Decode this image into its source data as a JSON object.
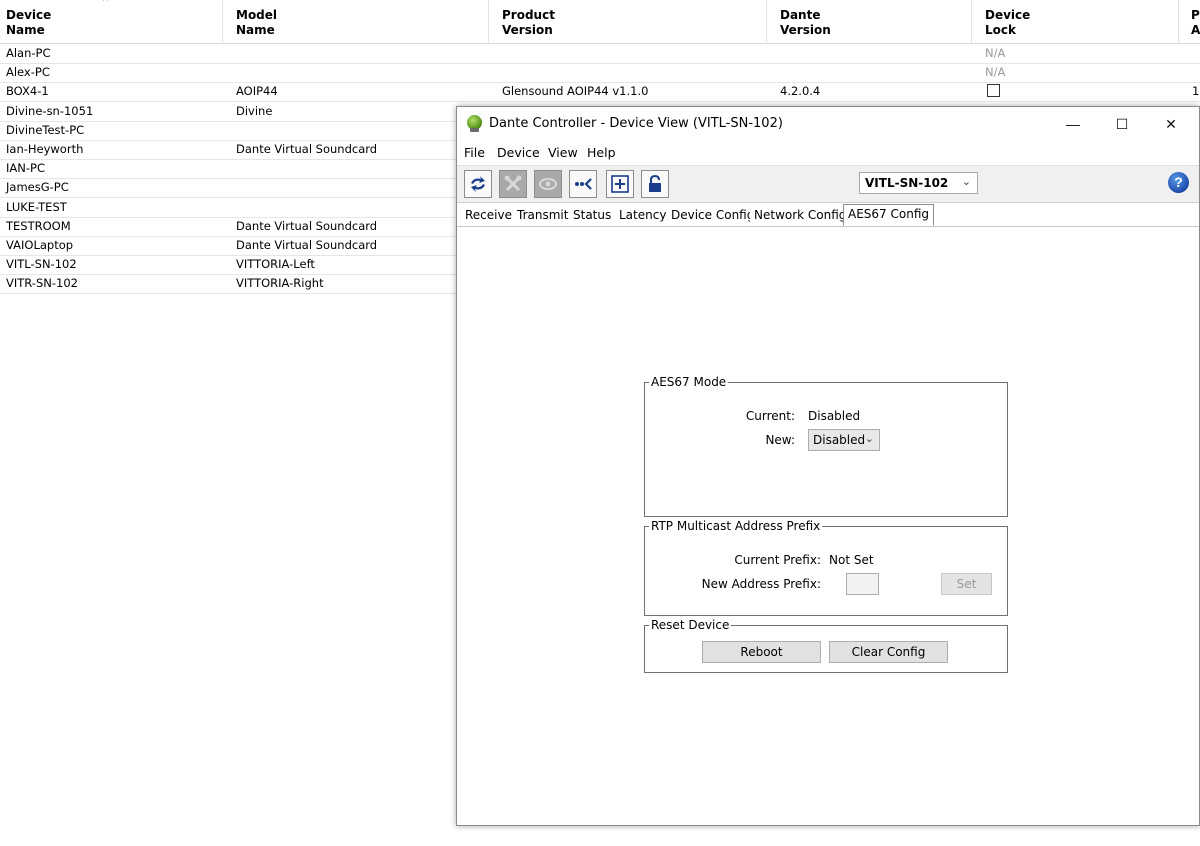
{
  "table": {
    "headers": [
      {
        "line1": "Device",
        "line2": "Name"
      },
      {
        "line1": "Model",
        "line2": "Name"
      },
      {
        "line1": "Product",
        "line2": "Version"
      },
      {
        "line1": "Dante",
        "line2": "Version"
      },
      {
        "line1": "Device",
        "line2": "Lock"
      },
      {
        "line1": "P",
        "line2": "A"
      }
    ],
    "rows": [
      {
        "name": "Alan-PC",
        "model": "",
        "product": "",
        "dante": "",
        "lock": "N/A",
        "extra": ""
      },
      {
        "name": "Alex-PC",
        "model": "",
        "product": "",
        "dante": "",
        "lock": "N/A",
        "extra": ""
      },
      {
        "name": "BOX4-1",
        "model": "AOIP44",
        "product": "Glensound AOIP44 v1.1.0",
        "dante": "4.2.0.4",
        "lock": "checkbox",
        "extra": "1"
      },
      {
        "name": "Divine-sn-1051",
        "model": "Divine",
        "product": "",
        "dante": "",
        "lock": "",
        "extra": ""
      },
      {
        "name": "DivineTest-PC",
        "model": "",
        "product": "",
        "dante": "",
        "lock": "",
        "extra": ""
      },
      {
        "name": "Ian-Heyworth",
        "model": "Dante Virtual Soundcard",
        "product": "",
        "dante": "",
        "lock": "",
        "extra": ""
      },
      {
        "name": "IAN-PC",
        "model": "",
        "product": "",
        "dante": "",
        "lock": "",
        "extra": ""
      },
      {
        "name": "JamesG-PC",
        "model": "",
        "product": "",
        "dante": "",
        "lock": "",
        "extra": ""
      },
      {
        "name": "LUKE-TEST",
        "model": "",
        "product": "",
        "dante": "",
        "lock": "",
        "extra": ""
      },
      {
        "name": "TESTROOM",
        "model": "Dante Virtual Soundcard",
        "product": "",
        "dante": "",
        "lock": "",
        "extra": ""
      },
      {
        "name": "VAIOLaptop",
        "model": "Dante Virtual Soundcard",
        "product": "",
        "dante": "",
        "lock": "",
        "extra": ""
      },
      {
        "name": "VITL-SN-102",
        "model": "VITTORIA-Left",
        "product": "",
        "dante": "",
        "lock": "",
        "extra": ""
      },
      {
        "name": "VITR-SN-102",
        "model": "VITTORIA-Right",
        "product": "",
        "dante": "",
        "lock": "",
        "extra": ""
      }
    ]
  },
  "dialog": {
    "title": "Dante Controller - Device View (VITL-SN-102)",
    "menu": [
      "File",
      "Device",
      "View",
      "Help"
    ],
    "window_controls": {
      "minimize": "—",
      "maximize": "☐",
      "close": "✕"
    },
    "toolbar": {
      "icons": [
        "refresh-icon",
        "tools-icon",
        "eye-icon",
        "connect-icon",
        "add-icon",
        "lock-icon"
      ],
      "device_select": "VITL-SN-102",
      "help": "?"
    },
    "tabs": [
      "Receive",
      "Transmit",
      "Status",
      "Latency",
      "Device Config",
      "Network Config",
      "AES67 Config"
    ],
    "active_tab": "AES67 Config",
    "aes67": {
      "legend": "AES67 Mode",
      "current_label": "Current:",
      "current_value": "Disabled",
      "new_label": "New:",
      "new_value": "Disabled"
    },
    "rtp": {
      "legend": "RTP Multicast Address Prefix",
      "current_label": "Current Prefix:",
      "current_value": "Not Set",
      "new_label": "New Address Prefix:",
      "new_value": "",
      "set_button": "Set"
    },
    "reset": {
      "legend": "Reset Device",
      "reboot_button": "Reboot",
      "clear_button": "Clear Config"
    }
  }
}
